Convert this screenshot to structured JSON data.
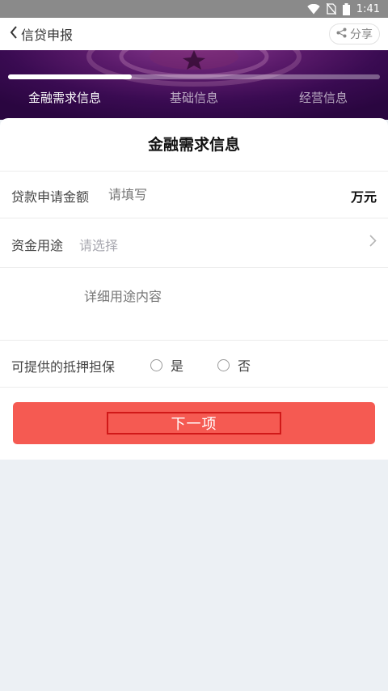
{
  "status_bar": {
    "time": "1:41"
  },
  "header": {
    "back_label": "信贷申报",
    "share_label": "分享"
  },
  "progress": {
    "value": 0.333
  },
  "steps": [
    {
      "label": "金融需求信息",
      "active": true
    },
    {
      "label": "基础信息",
      "active": false
    },
    {
      "label": "经营信息",
      "active": false
    }
  ],
  "form": {
    "title": "金融需求信息",
    "loan_amount": {
      "label": "贷款申请金额",
      "placeholder": "请填写",
      "unit": "万元"
    },
    "fund_purpose": {
      "label": "资金用途",
      "placeholder": "请选择"
    },
    "purpose_detail": {
      "placeholder": "详细用途内容"
    },
    "collateral": {
      "label": "可提供的抵押担保",
      "options": [
        "是",
        "否"
      ]
    }
  },
  "actions": {
    "next_label": "下一项"
  },
  "colors": {
    "accent": "#f55a52",
    "banner": "#3a0b52",
    "background": "#ecf0f4"
  }
}
